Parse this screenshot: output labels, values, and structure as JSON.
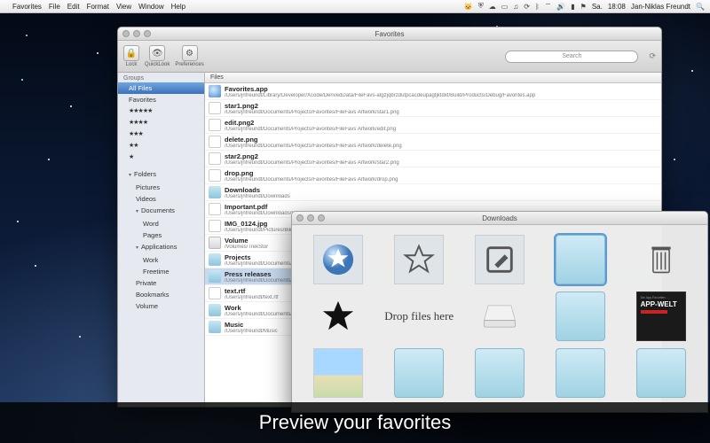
{
  "menubar": {
    "app": "Favorites",
    "items": [
      "File",
      "Edit",
      "Format",
      "View",
      "Window",
      "Help"
    ],
    "right_icons": [
      "cat-icon",
      "shield-icon",
      "cloud-icon",
      "displays-icon",
      "music-icon",
      "clock-icon",
      "bluetooth-icon",
      "wifi-icon",
      "volume-icon",
      "battery-icon",
      "flag-icon"
    ],
    "day": "Sa.",
    "time": "18:08",
    "user": "Jan-Niklas Freundt",
    "spotlight": "spotlight-icon"
  },
  "window": {
    "title": "Favorites",
    "toolbar": {
      "lock": {
        "label": "Lock"
      },
      "quicklook": {
        "label": "QuickLook"
      },
      "prefs": {
        "label": "Preferences"
      },
      "search_placeholder": "Search"
    },
    "sidebar": {
      "header_groups": "Groups",
      "all_files": "All Files",
      "favorites": "Favorites",
      "stars": [
        "★★★★★",
        "★★★★",
        "★★★",
        "★★",
        "★"
      ],
      "header_folders": "Folders",
      "folders": [
        {
          "label": "Pictures"
        },
        {
          "label": "Videos"
        },
        {
          "label": "Documents",
          "expanded": true,
          "children": [
            "Word",
            "Pages"
          ]
        },
        {
          "label": "Applications",
          "expanded": true,
          "children": [
            "Work",
            "Freetime"
          ]
        },
        {
          "label": "Private"
        },
        {
          "label": "Bookmarks"
        },
        {
          "label": "Volume"
        }
      ]
    },
    "files_header": "Files",
    "files": [
      {
        "icon": "app",
        "name": "Favorites.app",
        "path": "/Users/jnfreundt/Library/Developer/Xcode/DerivedData/FileFavs-atgzjqbrzdutpcacdeupagtjktdxf/Build/Products/Debug/Favorites.app"
      },
      {
        "icon": "img",
        "name": "star1.png2",
        "path": "/Users/jnfreundt/Documents/Projects/Favorites/FileFavs Artwork/star1.png"
      },
      {
        "icon": "img",
        "name": "edit.png2",
        "path": "/Users/jnfreundt/Documents/Projects/Favorites/FileFavs Artwork/edit.png"
      },
      {
        "icon": "img",
        "name": "delete.png",
        "path": "/Users/jnfreundt/Documents/Projects/Favorites/FileFavs Artwork/delete.png"
      },
      {
        "icon": "img",
        "name": "star2.png2",
        "path": "/Users/jnfreundt/Documents/Projects/Favorites/FileFavs Artwork/star2.png"
      },
      {
        "icon": "img",
        "name": "drop.png",
        "path": "/Users/jnfreundt/Documents/Projects/Favorites/FileFavs Artwork/drop.png"
      },
      {
        "icon": "folder",
        "name": "Downloads",
        "path": "/Users/jnfreundt/Downloads"
      },
      {
        "icon": "doc",
        "name": "Important.pdf",
        "path": "/Users/jnfreundt/Downloads/Bibli…"
      },
      {
        "icon": "img",
        "name": "IMG_0124.jpg",
        "path": "/Users/jnfreundt/Pictures/Bild…"
      },
      {
        "icon": "vol",
        "name": "Volume",
        "path": "/Volumes/TrekStor"
      },
      {
        "icon": "folder",
        "name": "Projects",
        "path": "/Users/jnfreundt/Documents/P…"
      },
      {
        "icon": "folder",
        "name": "Press releases",
        "path": "/Users/jnfreundt/Documents/P…",
        "selected": true
      },
      {
        "icon": "doc",
        "name": "text.rtf",
        "path": "/Users/jnfreundt/text.rtf"
      },
      {
        "icon": "folder",
        "name": "Work",
        "path": "/Users/jnfreundt/Documents/S…"
      },
      {
        "icon": "folder",
        "name": "Music",
        "path": "/Users/jnfreundt/Music"
      }
    ]
  },
  "quicklook": {
    "title": "Downloads",
    "drop_text": "Drop files here",
    "appwelt": "APP-WELT"
  },
  "caption": "Preview your favorites"
}
